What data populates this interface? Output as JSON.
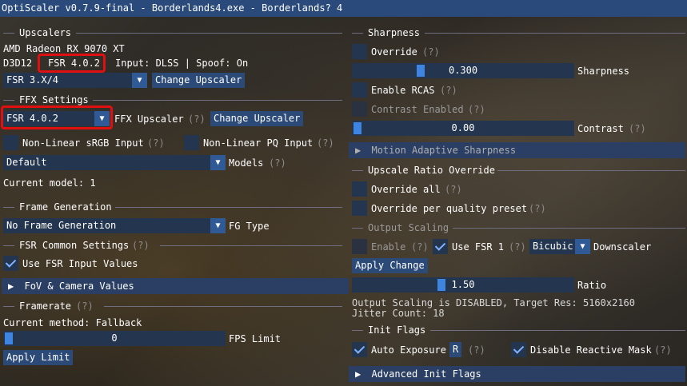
{
  "title": "OptiScaler v0.7.9-final - Borderlands4.exe - Borderlands? 4",
  "left": {
    "upscalers": {
      "header": "Upscalers",
      "gpu": "AMD Radeon RX 9070 XT",
      "api": "D3D12",
      "fsr_version": "FSR 4.0.2",
      "input_spoof": "Input: DLSS | Spoof: On",
      "upscaler_select": "FSR 3.X/4",
      "change_button": "Change Upscaler"
    },
    "ffx": {
      "header": "FFX Settings",
      "select": "FSR 4.0.2",
      "label": "FFX Upscaler",
      "help": "(?)",
      "change_button": "Change Upscaler",
      "nonlinear_srgb": "Non-Linear sRGB Input",
      "nonlinear_srgb_help": "(?)",
      "nonlinear_pq": "Non-Linear PQ Input",
      "nonlinear_pq_help": "(?)",
      "models_select": "Default",
      "models_label": "Models",
      "models_help": "(?)",
      "current_model": "Current model: 1"
    },
    "framegen": {
      "header": "Frame Generation",
      "select": "No Frame Generation",
      "label": "FG Type"
    },
    "fsr_common": {
      "header": "FSR Common Settings",
      "help": "(?)",
      "use_input_values": "Use FSR Input Values"
    },
    "fov": {
      "label": "FoV & Camera Values"
    },
    "framerate": {
      "header": "Framerate",
      "help": "(?)",
      "current_method": "Current method: Fallback",
      "fps_value": "0",
      "fps_label": "FPS Limit",
      "apply_button": "Apply Limit"
    }
  },
  "right": {
    "sharpness": {
      "header": "Sharpness",
      "override": "Override",
      "override_help": "(?)",
      "sharpness_value": "0.300",
      "sharpness_fraction": 0.3,
      "sharpness_label": "Sharpness",
      "enable_rcas": "Enable RCAS",
      "enable_rcas_help": "(?)",
      "contrast_enabled": "Contrast Enabled",
      "contrast_enabled_help": "(?)",
      "contrast_value": "0.00",
      "contrast_label": "Contrast",
      "contrast_help": "(?)"
    },
    "motion_adaptive": {
      "label": "Motion Adaptive Sharpness"
    },
    "ratio_override": {
      "header": "Upscale Ratio Override",
      "override_all": "Override all",
      "override_all_help": "(?)",
      "override_per_preset": "Override per quality preset",
      "override_per_preset_help": "(?)"
    },
    "output_scaling": {
      "header": "Output Scaling",
      "enable": "Enable",
      "enable_help": "(?)",
      "use_fsr1": "Use FSR 1",
      "use_fsr1_help": "(?)",
      "downscaler_select": "Bicubic",
      "downscaler_label": "Downscaler",
      "apply_button": "Apply Change",
      "ratio_value": "1.50",
      "ratio_label": "Ratio",
      "status": "Output Scaling is DISABLED, Target Res: 5160x2160",
      "jitter": "Jitter Count: 18"
    },
    "init_flags": {
      "header": "Init Flags",
      "auto_exposure": "Auto Exposure",
      "auto_exposure_key": "R",
      "auto_exposure_help": "(?)",
      "disable_reactive": "Disable Reactive Mask",
      "disable_reactive_help": "(?)"
    },
    "advanced": {
      "label": "Advanced Init Flags"
    }
  },
  "colors": {
    "title_bar": "#294a7a",
    "frame": "#24364f",
    "button": "#2b4a78",
    "accent": "#3d85e0",
    "highlight": "#e01010"
  }
}
